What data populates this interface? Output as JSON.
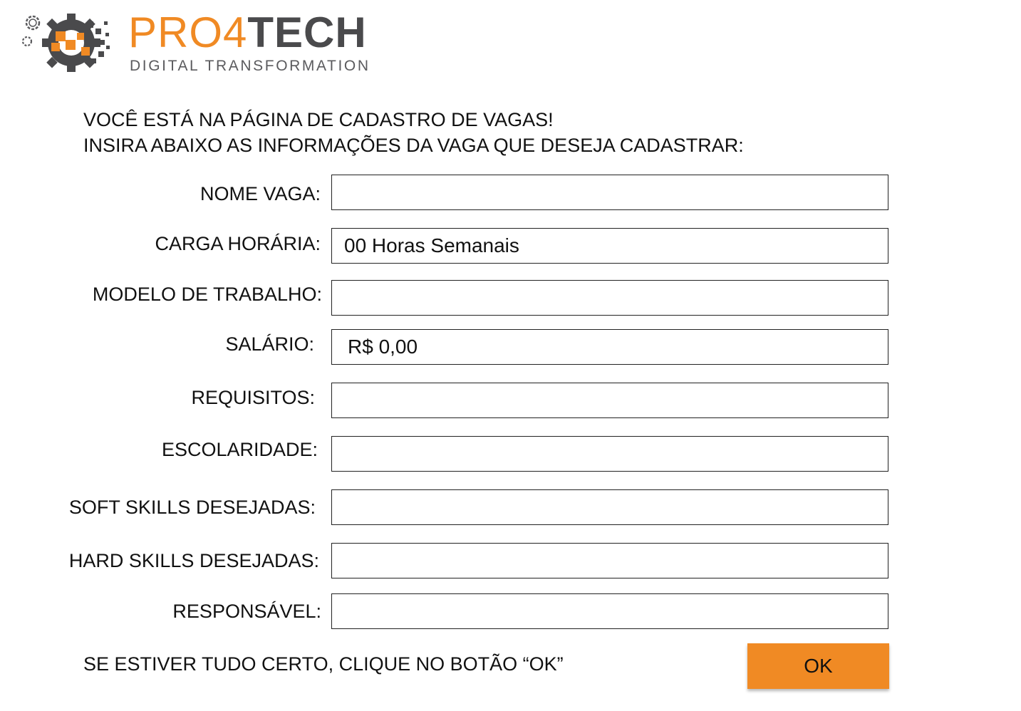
{
  "brand": {
    "name_part1": "PRO4",
    "name_part2": "TECH",
    "tagline": "DIGITAL TRANSFORMATION",
    "accent_color": "#f08a24",
    "dark_color": "#4a4a4c",
    "logo_icon": "gears-pixels-icon"
  },
  "intro": {
    "line1": "VOCÊ ESTÁ NA PÁGINA DE CADASTRO DE VAGAS!",
    "line2": "INSIRA ABAIXO AS INFORMAÇÕES DA VAGA QUE DESEJA CADASTRAR:"
  },
  "form": {
    "fields": [
      {
        "label": "NOME VAGA:",
        "value": ""
      },
      {
        "label": "CARGA HORÁRIA:",
        "value": "00 Horas Semanais"
      },
      {
        "label": "MODELO DE TRABALHO:",
        "value": ""
      },
      {
        "label": "SALÁRIO:",
        "value": "R$ 0,00"
      },
      {
        "label": "REQUISITOS:",
        "value": ""
      },
      {
        "label": "ESCOLARIDADE:",
        "value": ""
      },
      {
        "label": "SOFT SKILLS DESEJADAS:",
        "value": ""
      },
      {
        "label": "HARD SKILLS DESEJADAS:",
        "value": ""
      },
      {
        "label": "RESPONSÁVEL:",
        "value": ""
      }
    ]
  },
  "footer": {
    "instruction": "SE ESTIVER TUDO CERTO, CLIQUE NO BOTÃO “OK”",
    "ok_label": "OK"
  }
}
